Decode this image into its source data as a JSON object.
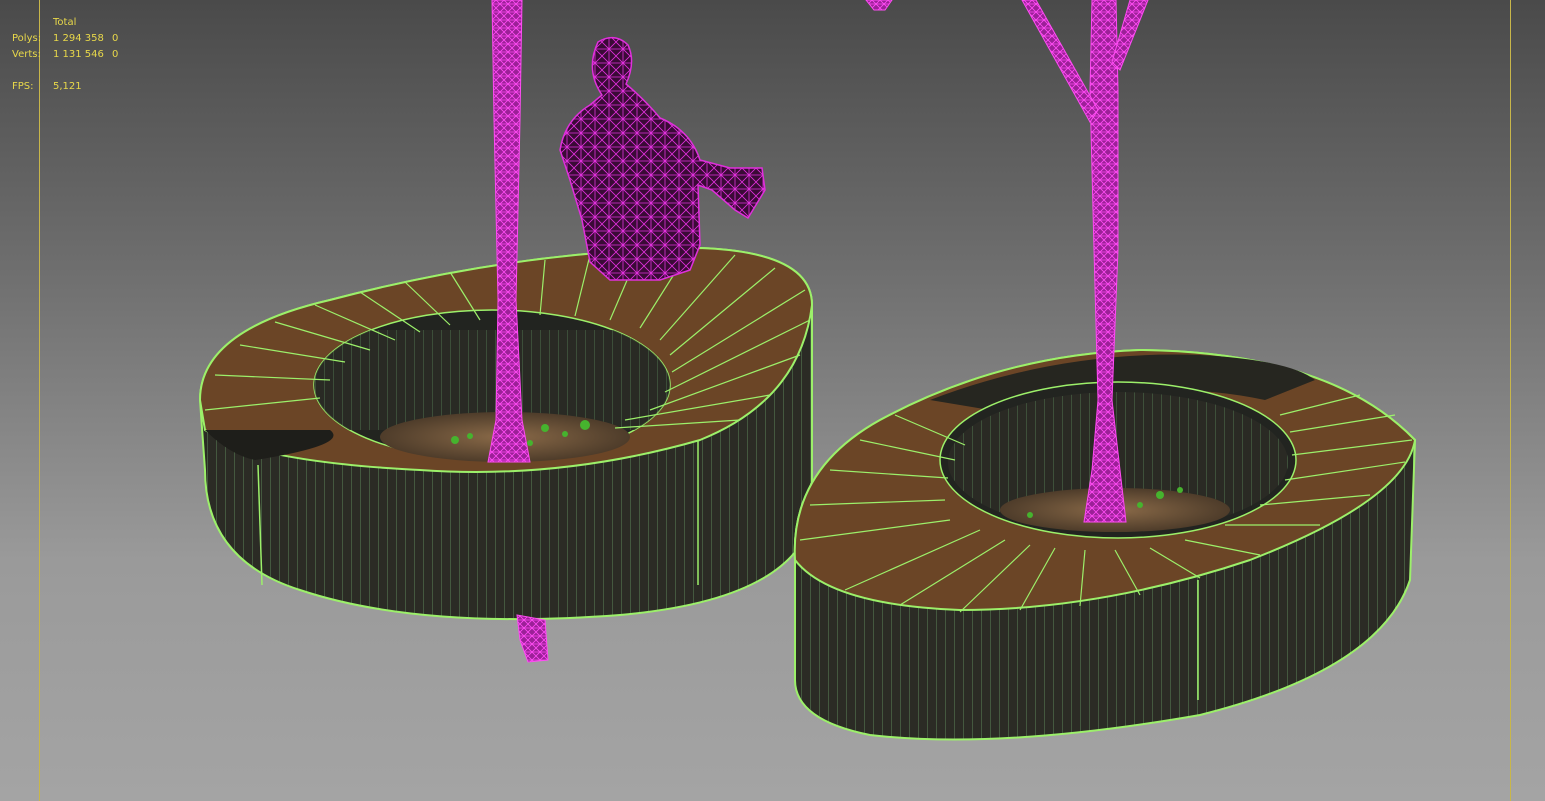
{
  "viewport_stats": {
    "header": "Total",
    "polys_label": "Polys:",
    "polys_total": "1 294 358",
    "polys_selected": "0",
    "verts_label": "Verts:",
    "verts_total": "1 131 546",
    "verts_selected": "0",
    "fps_label": "FPS:",
    "fps_value": "5,121"
  },
  "colors": {
    "stats_text": "#e8d84a",
    "safe_frame": "#c8b64a",
    "wire_selected": "#d42bd0",
    "wire_planter": "#9cf06a",
    "wood": "#6b4526",
    "planter_side": "#2a2a24"
  },
  "scene_objects": [
    "planter-bench",
    "tree-trunk",
    "seated-person-mesh"
  ]
}
